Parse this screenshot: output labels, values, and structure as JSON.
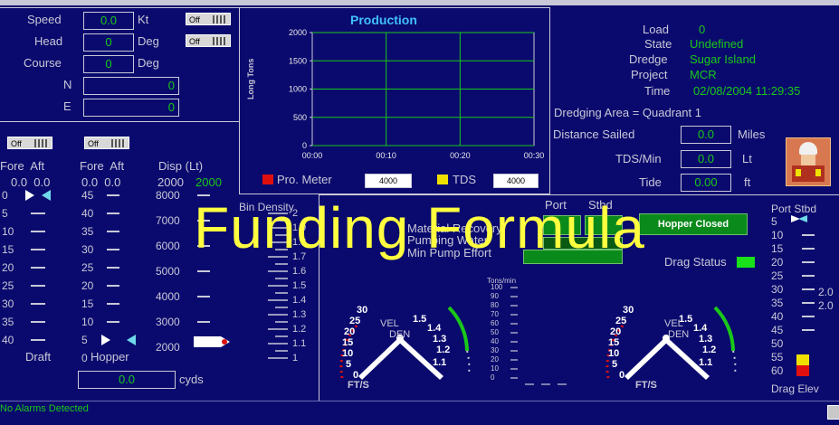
{
  "nav": {
    "speed": {
      "label": "Speed",
      "value": "0.0",
      "unit": "Kt",
      "toggle": "Off"
    },
    "head": {
      "label": "Head",
      "value": "0",
      "unit": "Deg",
      "toggle": "Off"
    },
    "course": {
      "label": "Course",
      "value": "0",
      "unit": "Deg"
    },
    "n": {
      "label": "N",
      "value": "0"
    },
    "e": {
      "label": "E",
      "value": "0"
    }
  },
  "production": {
    "title": "Production",
    "ylabel": "Long Tons",
    "legend_pro_meter": "Pro. Meter",
    "legend_pro_meter_value": "4000",
    "legend_tds": "TDS",
    "legend_tds_value": "4000"
  },
  "chart_data": {
    "type": "line",
    "title": "Production",
    "ylabel": "Long Tons",
    "xlabel": "",
    "x": [
      "00:00",
      "00:10",
      "00:20",
      "00:30"
    ],
    "yticks": [
      0,
      500,
      1000,
      1500,
      2000
    ],
    "ylim": [
      0,
      2000
    ],
    "series": [
      {
        "name": "Pro. Meter",
        "values": [],
        "color": "#e01010"
      },
      {
        "name": "TDS",
        "values": [],
        "color": "#f0e000"
      }
    ],
    "grid": true
  },
  "status": {
    "load_label": "Load",
    "load_value": "0",
    "state_label": "State",
    "state_value": "Undefined",
    "dredge_label": "Dredge",
    "dredge_value": "Sugar Island",
    "project_label": "Project",
    "project_value": "MCR",
    "time_label": "Time",
    "time_value": "02/08/2004 11:29:35",
    "area": "Dredging Area = Quadrant 1",
    "distance_label": "Distance Sailed",
    "distance_value": "0.0",
    "distance_unit": "Miles",
    "tds_label": "TDS/Min",
    "tds_value": "0.0",
    "tds_unit": "Lt",
    "tide_label": "Tide",
    "tide_value": "0.00",
    "tide_unit": "ft"
  },
  "draft": {
    "toggle1": "Off",
    "toggle2": "Off",
    "fore_aft1": "Fore  Aft",
    "fore_aft2": "Fore  Aft",
    "disp_label": "Disp (Lt)",
    "val1": "0.0  0.0",
    "val2": "0.0  0.0",
    "disp_val1": "2000",
    "disp_val2": "2000",
    "scale1": [
      "0",
      "5",
      "10",
      "15",
      "20",
      "25",
      "30",
      "35",
      "40"
    ],
    "scale2": [
      "45",
      "40",
      "35",
      "30",
      "25",
      "20",
      "15",
      "10",
      "5",
      "0"
    ],
    "scale3": [
      "8000",
      "7000",
      "6000",
      "5000",
      "4000",
      "3000",
      "2000"
    ],
    "draft_label": "Draft",
    "hopper_label": "Hopper",
    "cyds_value": "0.0",
    "cyds_unit": "cyds"
  },
  "bin_density": {
    "label": "Bin Density",
    "ticks": [
      "2",
      "1.9",
      "1.8",
      "1.7",
      "1.6",
      "1.5",
      "1.4",
      "1.3",
      "1.2",
      "1.1",
      "1"
    ]
  },
  "pumps": {
    "port_label": "Port",
    "stbd_label": "Stbd",
    "material_recovery": "Material Recovery",
    "pumping_water": "Pumping Water",
    "min_pump_effort": "Min Pump Effort",
    "hopper_closed": "Hopper Closed",
    "drag_status": "Drag Status",
    "tons_min_label": "Tons/min",
    "tons_scale": [
      "100",
      "90",
      "80",
      "70",
      "60",
      "50",
      "40",
      "30",
      "20",
      "10",
      "0"
    ],
    "vel_label": "VEL",
    "den_label": "DEN",
    "fts_label": "FT/S",
    "vel_ticks": [
      "30",
      "25",
      "20",
      "15",
      "10",
      "5",
      "0"
    ],
    "den_ticks": [
      "1.5",
      "1.4",
      "1.3",
      "1.2",
      "1.1"
    ]
  },
  "drag": {
    "port_stbd": "Port Stbd",
    "scale": [
      "5",
      "10",
      "15",
      "20",
      "25",
      "30",
      "35",
      "40",
      "45",
      "50",
      "55",
      "60"
    ],
    "val1": "2.0",
    "val2": "2.0",
    "elev_label": "Drag Elev"
  },
  "footer": {
    "alarms": "No Alarms Detected"
  },
  "overlay_text": "Funding Formula"
}
